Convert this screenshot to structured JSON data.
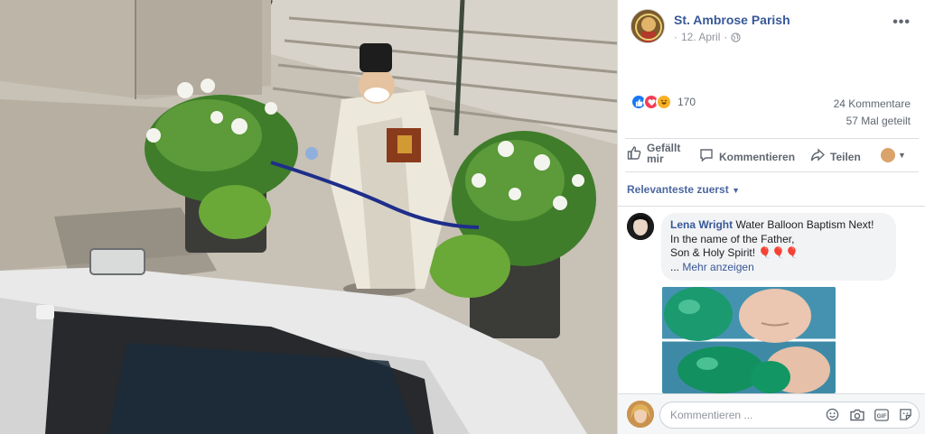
{
  "post": {
    "page_name": "St. Ambrose Parish",
    "date": "12. April",
    "date_prefix": "·"
  },
  "reactions": {
    "count": "170",
    "types": [
      "like-icon",
      "love-icon",
      "haha-icon"
    ]
  },
  "stats": {
    "comments": "24 Kommentare",
    "shares": "57 Mal geteilt"
  },
  "actions": {
    "like": "Gefällt mir",
    "comment": "Kommentieren",
    "share": "Teilen"
  },
  "sort": {
    "label": "Relevanteste zuerst"
  },
  "comment": {
    "author": "Lena Wright",
    "text_line1": "Water Balloon Baptism Next!",
    "text_line2": "In the name of the Father,",
    "text_line3": "Son & Holy Spirit!",
    "balloons": "🎈🎈🎈",
    "more_prefix": "...",
    "more": "Mehr anzeigen"
  },
  "composer": {
    "placeholder": "Kommentieren ..."
  },
  "colors": {
    "link": "#385898",
    "like": "#1877f2",
    "love": "#f33e58",
    "haha": "#f7b125"
  }
}
